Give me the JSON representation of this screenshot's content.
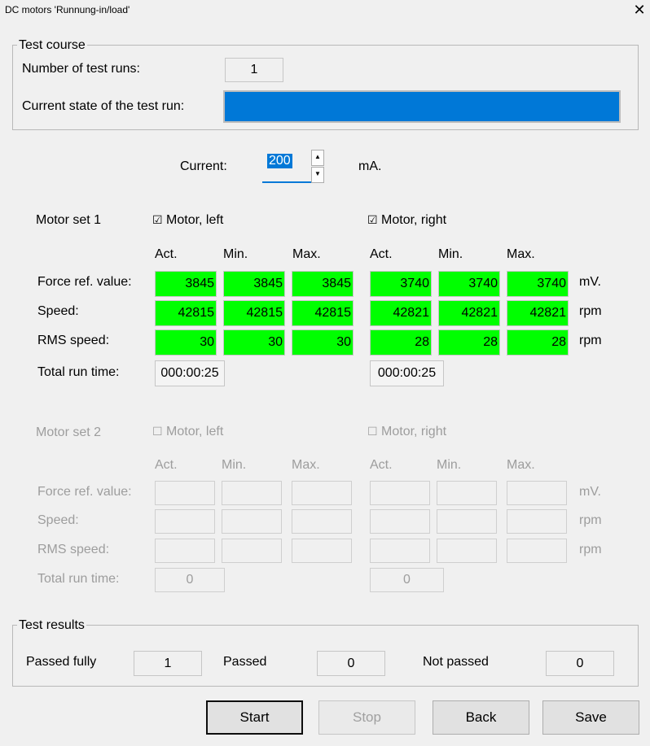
{
  "window": {
    "title": "DC motors 'Runnung-in/load'",
    "close": "✕"
  },
  "test_course": {
    "legend": "Test course",
    "runs_label": "Number of test runs:",
    "runs_value": "1",
    "state_label": "Current state of the test run:",
    "progress_fraction": 1.0
  },
  "current": {
    "label": "Current:",
    "value": "200",
    "unit": "mA.",
    "up": "▲",
    "down": "▼"
  },
  "set1": {
    "title": "Motor set 1",
    "left_check": "☑",
    "left_label": "Motor, left",
    "right_check": "☑",
    "right_label": "Motor, right",
    "cols": [
      "Act.",
      "Min.",
      "Max.",
      "Act.",
      "Min.",
      "Max."
    ],
    "rows": [
      {
        "label": "Force ref. value:",
        "unit": "mV.",
        "values": [
          "3845",
          "3845",
          "3845",
          "3740",
          "3740",
          "3740"
        ]
      },
      {
        "label": "Speed:",
        "unit": "rpm",
        "values": [
          "42815",
          "42815",
          "42815",
          "42821",
          "42821",
          "42821"
        ]
      },
      {
        "label": "RMS speed:",
        "unit": "rpm",
        "values": [
          "30",
          "30",
          "30",
          "28",
          "28",
          "28"
        ]
      }
    ],
    "total_label": "Total run time:",
    "total_left": "000:00:25",
    "total_right": "000:00:25"
  },
  "set2": {
    "title": "Motor set 2",
    "left_check": "☐",
    "left_label": "Motor, left",
    "right_check": "☐",
    "right_label": "Motor, right",
    "cols": [
      "Act.",
      "Min.",
      "Max.",
      "Act.",
      "Min.",
      "Max."
    ],
    "rows": [
      {
        "label": "Force ref. value:",
        "unit": "mV."
      },
      {
        "label": "Speed:",
        "unit": "rpm"
      },
      {
        "label": "RMS speed:",
        "unit": "rpm"
      }
    ],
    "total_label": "Total run time:",
    "total_left": "0",
    "total_right": "0"
  },
  "results": {
    "legend": "Test results",
    "passed_fully_label": "Passed fully",
    "passed_fully_value": "1",
    "passed_label": "Passed",
    "passed_value": "0",
    "not_passed_label": "Not passed",
    "not_passed_value": "0"
  },
  "buttons": {
    "start": "Start",
    "stop": "Stop",
    "back": "Back",
    "save": "Save"
  },
  "colors": {
    "accent": "#0078d7",
    "ok": "#00ff00"
  }
}
